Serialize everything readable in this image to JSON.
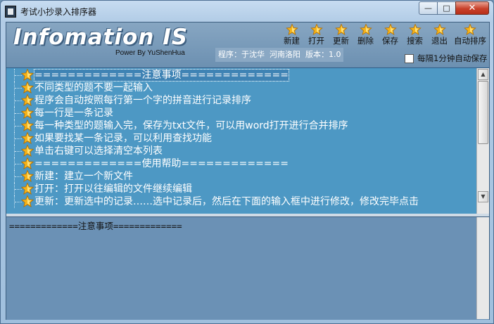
{
  "window": {
    "title": "考试小抄录入排序器",
    "controls": {
      "minimize": "—",
      "maximize": "□",
      "close": "✕"
    }
  },
  "header": {
    "logo": "Infomation IS",
    "powered_by": "Power By YuShenHua",
    "info": "程序：于沈华  河南洛阳  版本：1.0"
  },
  "toolbar": [
    {
      "label": "新建",
      "icon": "star-icon"
    },
    {
      "label": "打开",
      "icon": "star-icon"
    },
    {
      "label": "更新",
      "icon": "star-icon"
    },
    {
      "label": "删除",
      "icon": "star-icon"
    },
    {
      "label": "保存",
      "icon": "star-icon"
    },
    {
      "label": "搜索",
      "icon": "star-icon"
    },
    {
      "label": "退出",
      "icon": "star-icon"
    },
    {
      "label": "自动排序",
      "icon": "star-icon"
    }
  ],
  "autosave": {
    "label": "每隔1分钟自动保存",
    "checked": false
  },
  "tree": {
    "items": [
      {
        "label": "=============注意事项=============",
        "selected": true
      },
      {
        "label": "不同类型的题不要一起输入"
      },
      {
        "label": "程序会自动按照每行第一个字的拼音进行记录排序"
      },
      {
        "label": "每一行是一条记录"
      },
      {
        "label": "每一种类型的题输入完，保存为txt文件，可以用word打开进行合并排序"
      },
      {
        "label": "如果要找某一条记录，可以利用查找功能"
      },
      {
        "label": "单击右键可以选择清空本列表"
      },
      {
        "label": "=============使用帮助============="
      },
      {
        "label": "新建：建立一个新文件"
      },
      {
        "label": "打开：打开以往编辑的文件继续编辑"
      },
      {
        "label": "更新：更新选中的记录……选中记录后，然后在下面的输入框中进行修改，修改完毕点击"
      }
    ]
  },
  "editor": {
    "text": "=============注意事项============="
  },
  "colors": {
    "tree_bg": "#4d98c4",
    "editor_bg": "#6b91b5",
    "header_bg": "#7c9dbb",
    "star": "#f5b31a"
  }
}
